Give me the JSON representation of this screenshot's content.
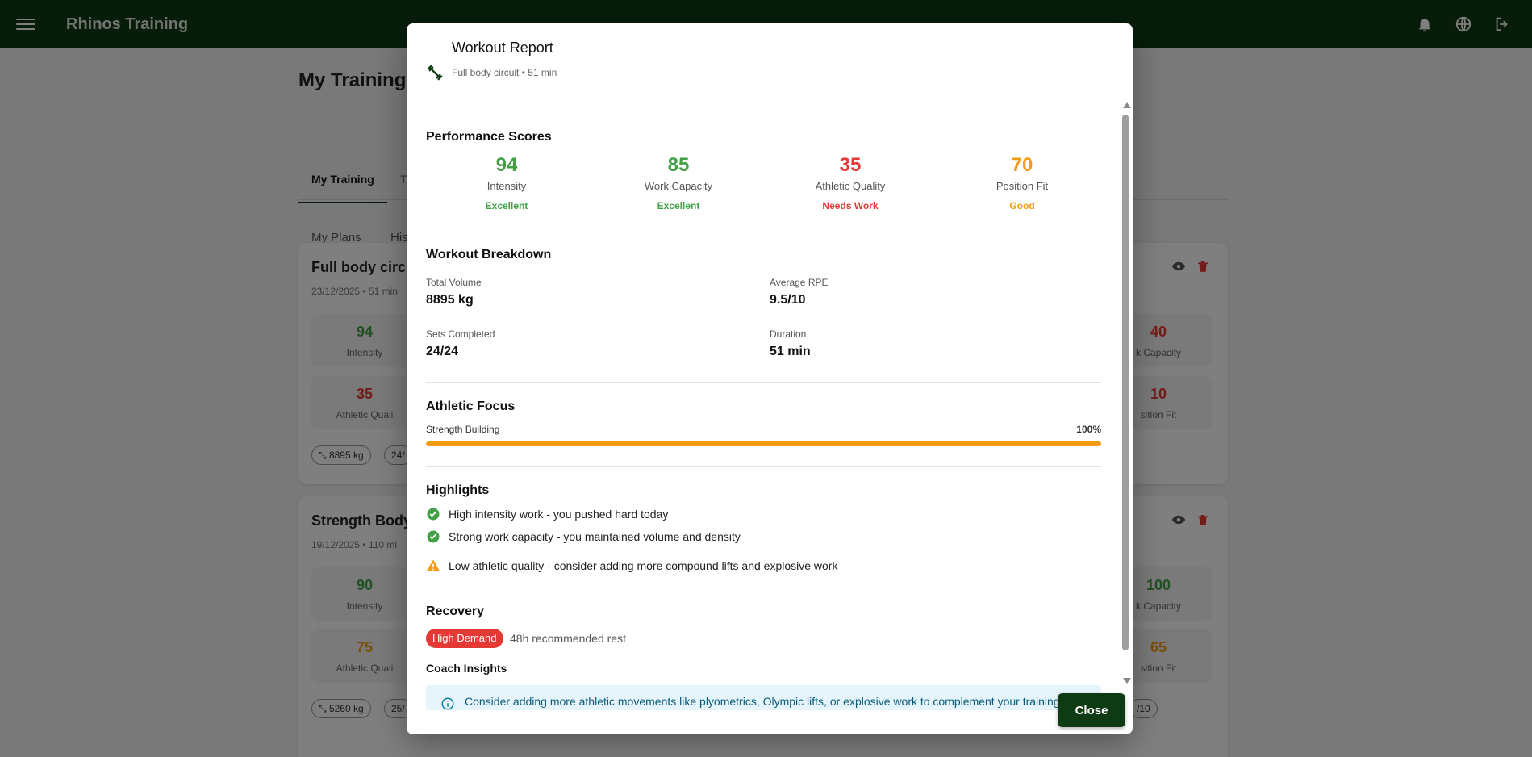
{
  "app": {
    "title": "Rhinos Training"
  },
  "page": {
    "title": "My Training",
    "tabs": [
      "My Training",
      "T"
    ],
    "subtabs": [
      "My Plans",
      "His"
    ]
  },
  "cards": [
    {
      "title": "Full body circu",
      "meta": "23/12/2025 • 51 min",
      "stats_left": [
        {
          "value": "94",
          "label": "Intensity",
          "color": "#43a047"
        },
        {
          "value": "35",
          "label": "Athletic Quali",
          "color": "#e53935"
        }
      ],
      "stats_right": [
        {
          "value": "40",
          "label": "k Capacity",
          "color": "#e53935"
        },
        {
          "value": "10",
          "label": "sition Fit",
          "color": "#e53935"
        }
      ],
      "chips": [
        "8895 kg",
        "24/"
      ]
    },
    {
      "title": "Strength Body",
      "meta": "19/12/2025 • 110 mi",
      "stats_left": [
        {
          "value": "90",
          "label": "Intensity",
          "color": "#43a047"
        },
        {
          "value": "75",
          "label": "Athletic Quali",
          "color": "#f39c12"
        }
      ],
      "stats_right": [
        {
          "value": "100",
          "label": "k Capacity",
          "color": "#43a047"
        },
        {
          "value": "65",
          "label": "sition Fit",
          "color": "#f39c12"
        }
      ],
      "chips": [
        "5260 kg",
        "25/",
        "/10"
      ]
    }
  ],
  "modal": {
    "title": "Workout Report",
    "subtitle": "Full body circuit • 51 min",
    "performance": {
      "title": "Performance Scores",
      "scores": [
        {
          "value": "94",
          "label": "Intensity",
          "rating": "Excellent",
          "color": "#43a047"
        },
        {
          "value": "85",
          "label": "Work Capacity",
          "rating": "Excellent",
          "color": "#43a047"
        },
        {
          "value": "35",
          "label": "Athletic Quality",
          "rating": "Needs Work",
          "color": "#e53935"
        },
        {
          "value": "70",
          "label": "Position Fit",
          "rating": "Good",
          "color": "#f39c12"
        }
      ]
    },
    "breakdown": {
      "title": "Workout Breakdown",
      "items": [
        {
          "label": "Total Volume",
          "value": "8895 kg"
        },
        {
          "label": "Average RPE",
          "value": "9.5/10"
        },
        {
          "label": "Sets Completed",
          "value": "24/24"
        },
        {
          "label": "Duration",
          "value": "51 min"
        }
      ]
    },
    "focus": {
      "title": "Athletic Focus",
      "label": "Strength Building",
      "percent_text": "100%",
      "percent": 100
    },
    "highlights": {
      "title": "Highlights",
      "items": [
        {
          "text": "High intensity work - you pushed hard today",
          "icon": "check-circle-icon"
        },
        {
          "text": "Strong work capacity - you maintained volume and density",
          "icon": "check-circle-icon"
        },
        {
          "text": "Low athletic quality - consider adding more compound lifts and explosive work",
          "icon": "warning-icon"
        }
      ]
    },
    "recovery": {
      "title": "Recovery",
      "badge": "High Demand",
      "rest": "48h recommended rest"
    },
    "coach": {
      "title": "Coach Insights",
      "insight": "Consider adding more athletic movements like plyometrics, Olympic lifts, or explosive work to complement your training."
    },
    "close_label": "Close"
  },
  "colors": {
    "brand": "#0f3b14",
    "good": "#43a047",
    "bad": "#e53935",
    "warn": "#f39c12",
    "info_bg": "#e6f4fb"
  }
}
